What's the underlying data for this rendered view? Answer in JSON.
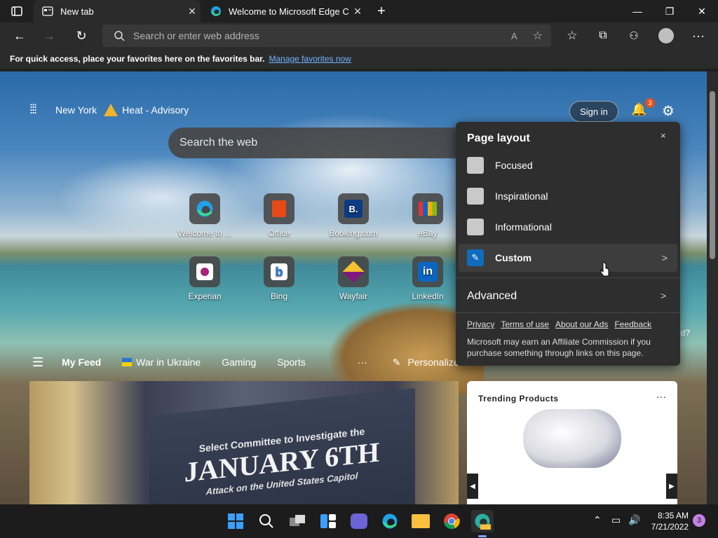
{
  "tabs": [
    {
      "title": "New tab",
      "active": true
    },
    {
      "title": "Welcome to Microsoft Edge Can",
      "active": false
    }
  ],
  "address": {
    "placeholder": "Search or enter web address"
  },
  "favbar": {
    "text": "For quick access, place your favorites here on the favorites bar.",
    "link": "Manage favorites now"
  },
  "weather": {
    "city": "New York",
    "alert": "Heat - Advisory"
  },
  "search": {
    "placeholder": "Search the web"
  },
  "signin": "Sign in",
  "notifications": {
    "count": "3"
  },
  "tiles": [
    {
      "label": "Welcome to ...",
      "icon": "edge-icon"
    },
    {
      "label": "Office",
      "icon": "office-icon"
    },
    {
      "label": "Booking.com",
      "icon": "booking-icon",
      "glyph": "B."
    },
    {
      "label": "eBay",
      "icon": "ebay-icon"
    },
    {
      "label": "Experian",
      "icon": "experian-icon"
    },
    {
      "label": "Bing",
      "icon": "bing-icon",
      "glyph": "b"
    },
    {
      "label": "Wayfair",
      "icon": "wayfair-icon"
    },
    {
      "label": "LinkedIn",
      "icon": "linkedin-icon",
      "glyph": "in"
    }
  ],
  "feed": {
    "tabs": [
      "My Feed",
      "War in Ukraine",
      "Gaming",
      "Sports"
    ],
    "more": "···",
    "personalize": "Personalize"
  },
  "news": {
    "line1": "Select Committee to Investigate the",
    "line2": "JANUARY 6TH",
    "line3": "Attack on the United States Capitol"
  },
  "trending": {
    "title": "Trending Products",
    "more": "···"
  },
  "panel": {
    "title": "Page layout",
    "close": "×",
    "options": [
      {
        "label": "Focused"
      },
      {
        "label": "Inspirational"
      },
      {
        "label": "Informational"
      },
      {
        "label": "Custom",
        "selected": true
      }
    ],
    "advanced": "Advanced",
    "links": [
      "Privacy",
      "Terms of use",
      "About our Ads",
      "Feedback"
    ],
    "affiliate": "Microsoft may earn an Affiliate Commission if you purchase something through links on this page.",
    "partial_text": "nd?"
  },
  "clock": {
    "time": "8:35 AM",
    "date": "7/21/2022"
  },
  "taskbar_badge": "3",
  "colors": {
    "accent": "#0f6cbd",
    "link": "#6eb5ff",
    "notify": "#e25322"
  }
}
